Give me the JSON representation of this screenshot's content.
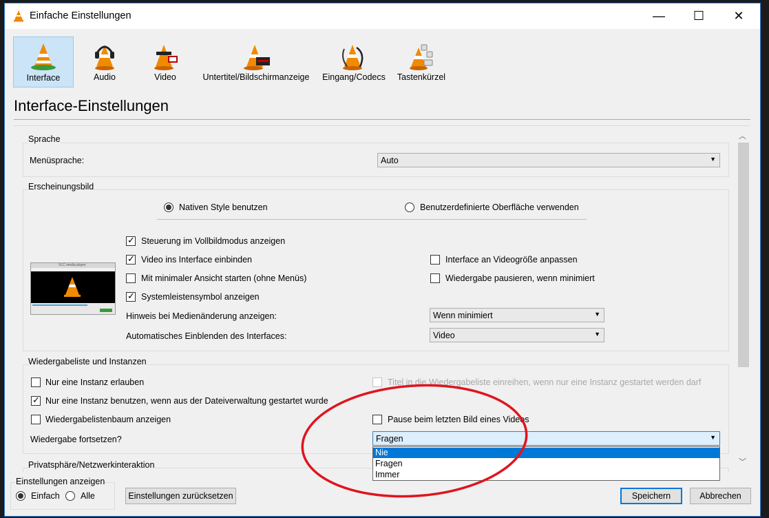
{
  "window": {
    "title": "Einfache Einstellungen",
    "minimize_glyph": "—",
    "maximize_glyph": "☐",
    "close_glyph": "✕"
  },
  "toolbar": {
    "items": [
      {
        "label": "Interface",
        "icon": "vlc-cone-icon"
      },
      {
        "label": "Audio",
        "icon": "headphones-cone-icon"
      },
      {
        "label": "Video",
        "icon": "glasses-cone-icon"
      },
      {
        "label": "Untertitel/Bildschirmanzeige",
        "icon": "subtitle-cone-icon"
      },
      {
        "label": "Eingang/Codecs",
        "icon": "cable-cone-icon"
      },
      {
        "label": "Tastenkürzel",
        "icon": "hotkeys-cone-icon"
      }
    ]
  },
  "heading": "Interface-Einstellungen",
  "sprache": {
    "group_label": "Sprache",
    "menu_lang_label": "Menüsprache:",
    "menu_lang_value": "Auto"
  },
  "erscheinungsbild": {
    "group_label": "Erscheinungsbild",
    "radio_native": "Nativen Style benutzen",
    "radio_custom": "Benutzerdefinierte Oberfläche verwenden",
    "cb_fullscreen_controls": "Steuerung im Vollbildmodus anzeigen",
    "cb_embed_video": "Video ins Interface einbinden",
    "cb_minimal_view": "Mit minimaler Ansicht starten (ohne Menüs)",
    "cb_systray": "Systemleistensymbol anzeigen",
    "cb_resize_interface": "Interface an Videogröße anpassen",
    "cb_pause_minimized": "Wiedergabe pausieren, wenn minimiert",
    "notify_label": "Hinweis bei Medienänderung anzeigen:",
    "notify_value": "Wenn minimiert",
    "autoraise_label": "Automatisches Einblenden des Interfaces:",
    "autoraise_value": "Video",
    "preview_window_title": "VLC media player"
  },
  "playlist": {
    "group_label": "Wiedergabeliste und Instanzen",
    "cb_one_instance": "Nur eine Instanz erlauben",
    "cb_enqueue": "Titel in die Wiedergabeliste einreihen, wenn nur eine Instanz gestartet werden darf",
    "cb_one_instance_fm": "Nur eine Instanz benutzen, wenn aus der Dateiverwaltung gestartet wurde",
    "cb_tree": "Wiedergabelistenbaum anzeigen",
    "cb_pause_last": "Pause beim letzten Bild eines Videos",
    "resume_label": "Wiedergabe fortsetzen?",
    "resume_value": "Fragen",
    "resume_options": [
      "Nie",
      "Fragen",
      "Immer"
    ]
  },
  "privacy": {
    "group_label": "Privatsphäre/Netzwerkinteraktion"
  },
  "footer": {
    "show_label": "Einstellungen anzeigen",
    "radio_simple": "Einfach",
    "radio_all": "Alle",
    "reset_button": "Einstellungen zurücksetzen",
    "save_button": "Speichern",
    "cancel_button": "Abbrechen"
  },
  "colors": {
    "accent": "#0078d7",
    "selected_tab": "#cce4f7",
    "annotation": "#e0141e"
  }
}
